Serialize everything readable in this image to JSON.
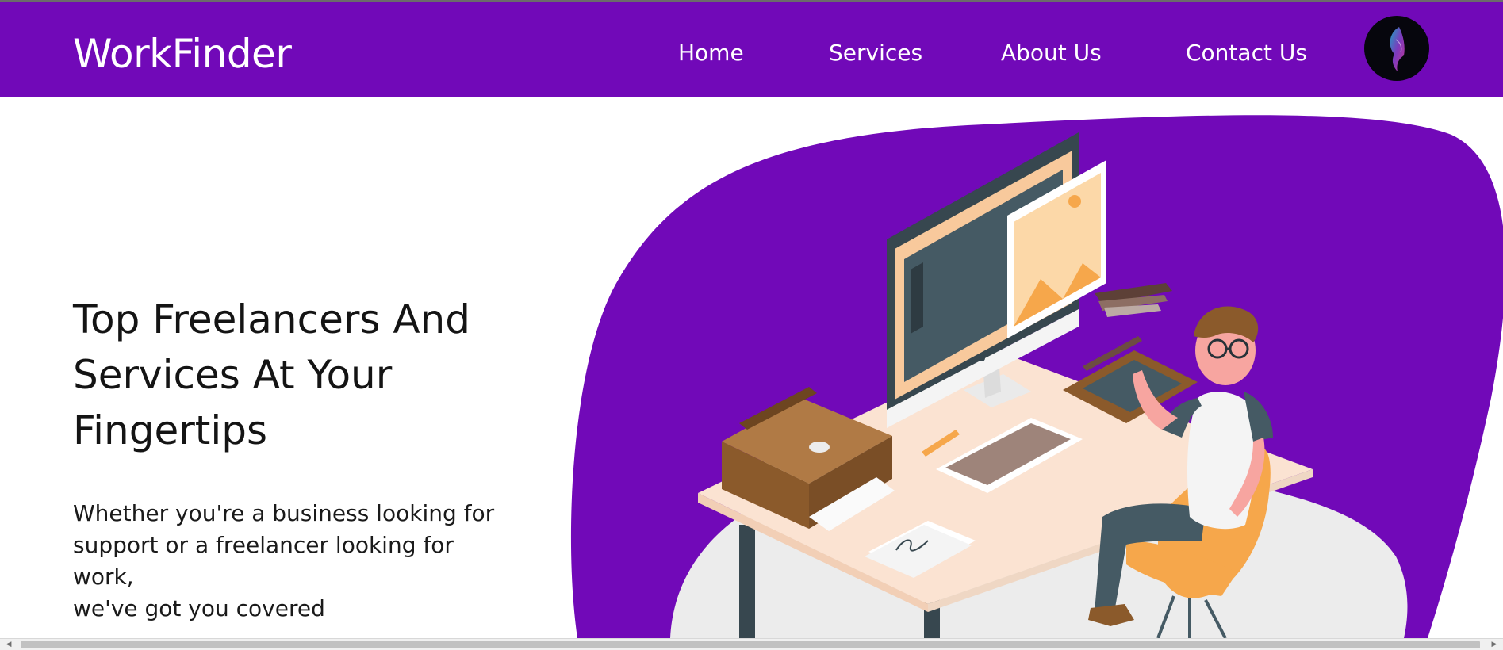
{
  "header": {
    "brand": "WorkFinder",
    "nav": [
      {
        "label": "Home"
      },
      {
        "label": "Services"
      },
      {
        "label": "About Us"
      },
      {
        "label": "Contact Us"
      }
    ],
    "avatar_icon": "profile-avatar-icon"
  },
  "hero": {
    "title_line1": "Top Freelancers And",
    "title_line2": "Services At Your",
    "title_line3": "Fingertips",
    "subtitle_line1": "Whether you're a business looking for",
    "subtitle_line2": "support or a freelancer looking for work,",
    "subtitle_line3": "we've got you covered",
    "illustration_icon": "freelancer-at-desk-illustration",
    "signature_text": "fue"
  },
  "colors": {
    "brand_purple": "#7109b8",
    "text_dark": "#141414",
    "white": "#ffffff"
  },
  "scrollbar": {
    "left_arrow_icon": "chevron-left-icon",
    "right_arrow_icon": "chevron-right-icon"
  }
}
